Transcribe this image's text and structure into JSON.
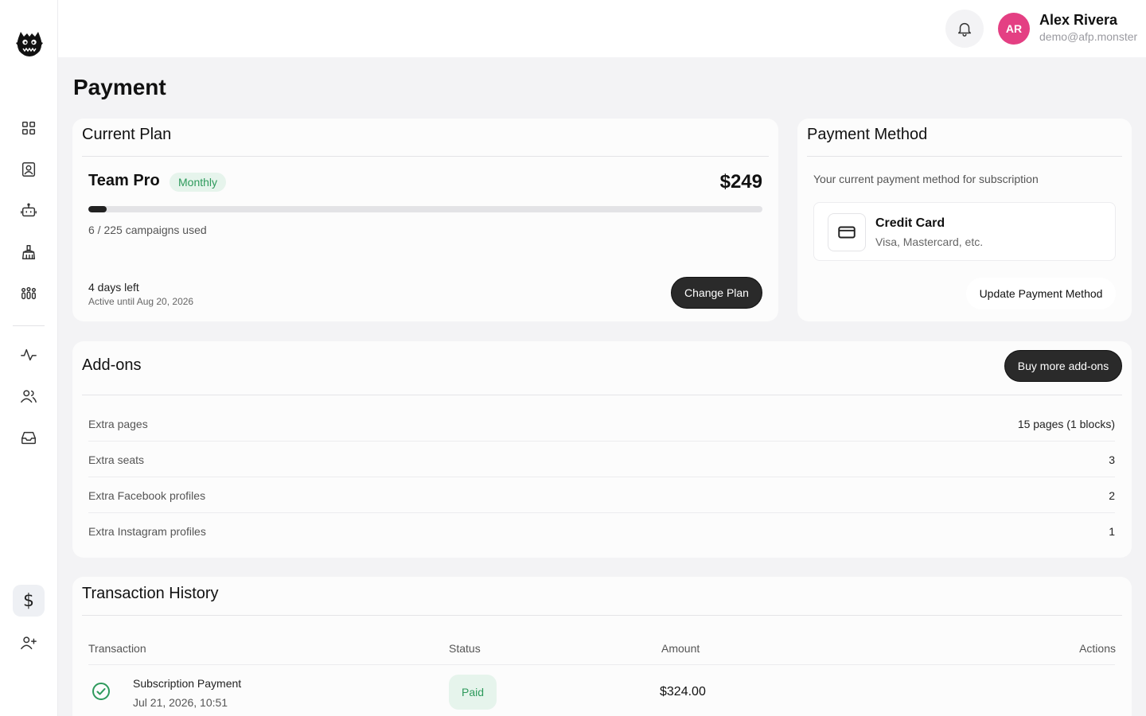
{
  "header": {
    "user_initials": "AR",
    "user_name": "Alex Rivera",
    "user_email": "demo@afp.monster",
    "more_label": "···"
  },
  "sidebar": {
    "items": [
      {
        "icon": "dashboard-grid-icon"
      },
      {
        "icon": "contact-card-icon"
      },
      {
        "icon": "robot-icon"
      },
      {
        "icon": "cleaning-brush-icon"
      },
      {
        "icon": "groups-icon"
      },
      {
        "icon": "activity-icon"
      },
      {
        "icon": "users-icon"
      },
      {
        "icon": "inbox-icon"
      },
      {
        "icon": "dollar-icon",
        "glyph": "$",
        "active": true
      },
      {
        "icon": "add-user-icon"
      }
    ]
  },
  "page": {
    "title": "Payment"
  },
  "current_plan": {
    "title": "Current Plan",
    "plan_name": "Team Pro",
    "billing_badge": "Monthly",
    "price": "$249",
    "usage_text": "6 / 225 campaigns used",
    "usage_fraction": 0.0267,
    "days_left": "4 days left",
    "active_until": "Active until Aug 20, 2026",
    "change_plan_label": "Change Plan"
  },
  "payment_method": {
    "title": "Payment Method",
    "description": "Your current payment method for subscription",
    "method_name": "Credit Card",
    "method_sub": "Visa, Mastercard, etc.",
    "update_label": "Update Payment Method"
  },
  "addons": {
    "title": "Add-ons",
    "buy_label": "Buy more add-ons",
    "rows": [
      {
        "label": "Extra pages",
        "value": "15 pages (1 blocks)"
      },
      {
        "label": "Extra seats",
        "value": "3"
      },
      {
        "label": "Extra Facebook profiles",
        "value": "2"
      },
      {
        "label": "Extra Instagram profiles",
        "value": "1"
      }
    ]
  },
  "transactions": {
    "title": "Transaction History",
    "columns": [
      "Transaction",
      "Status",
      "Amount",
      "Actions"
    ],
    "rows": [
      {
        "name": "Subscription Payment",
        "date": "Jul 21, 2026, 10:51",
        "status": "Paid",
        "amount": "$324.00"
      }
    ]
  },
  "colors": {
    "accent_green": "#2e9a5c",
    "avatar_pink": "#e43f83",
    "dark_button": "#2a2a2a"
  }
}
